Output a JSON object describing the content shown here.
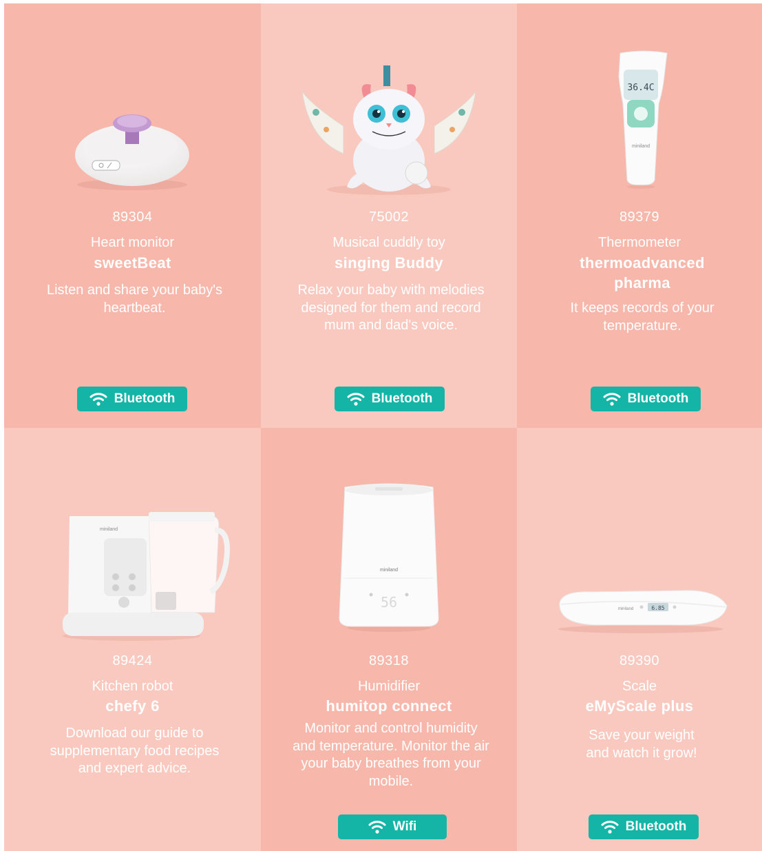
{
  "products": [
    {
      "code": "89304",
      "category": "Heart monitor",
      "name": "sweetBeat",
      "description": "Listen and share your baby's heartbeat.",
      "connectivity": "Bluetooth",
      "connectivity_icon": "wifi-icon",
      "image": "heart-monitor-image"
    },
    {
      "code": "75002",
      "category": "Musical cuddly toy",
      "name": "singing Buddy",
      "description": "Relax your baby with melodies designed for them and record mum and dad's voice.",
      "connectivity": "Bluetooth",
      "connectivity_icon": "wifi-icon",
      "image": "cuddly-toy-image"
    },
    {
      "code": "89379",
      "category": "Thermometer",
      "name": "thermoadvanced pharma",
      "description": "It keeps records of your temperature.",
      "connectivity": "Bluetooth",
      "connectivity_icon": "wifi-icon",
      "image": "thermometer-image",
      "display_reading": "36.4C",
      "brand": "miniland"
    },
    {
      "code": "89424",
      "category": "Kitchen robot",
      "name": "chefy 6",
      "description": "Download our guide to supplementary food recipes and expert advice.",
      "connectivity": "",
      "image": "kitchen-robot-image",
      "brand": "miniland"
    },
    {
      "code": "89318",
      "category": "Humidifier",
      "name": "humitop connect",
      "description": "Monitor and control humidity and temperature. Monitor the air your baby breathes from your mobile.",
      "connectivity": "Wifi",
      "connectivity_icon": "wifi-icon",
      "image": "humidifier-image",
      "display_reading": "56",
      "brand": "miniland"
    },
    {
      "code": "89390",
      "category": "Scale",
      "name": "eMyScale plus",
      "description": "Save your weight and watch it grow!",
      "connectivity": "Bluetooth",
      "connectivity_icon": "wifi-icon",
      "image": "scale-image",
      "display_reading": "6.85",
      "brand": "miniland"
    }
  ],
  "colors": {
    "tile_dark": "#f7b7aa",
    "tile_light": "#f9c9bf",
    "badge": "#14b5a7",
    "text": "#ffffff"
  }
}
